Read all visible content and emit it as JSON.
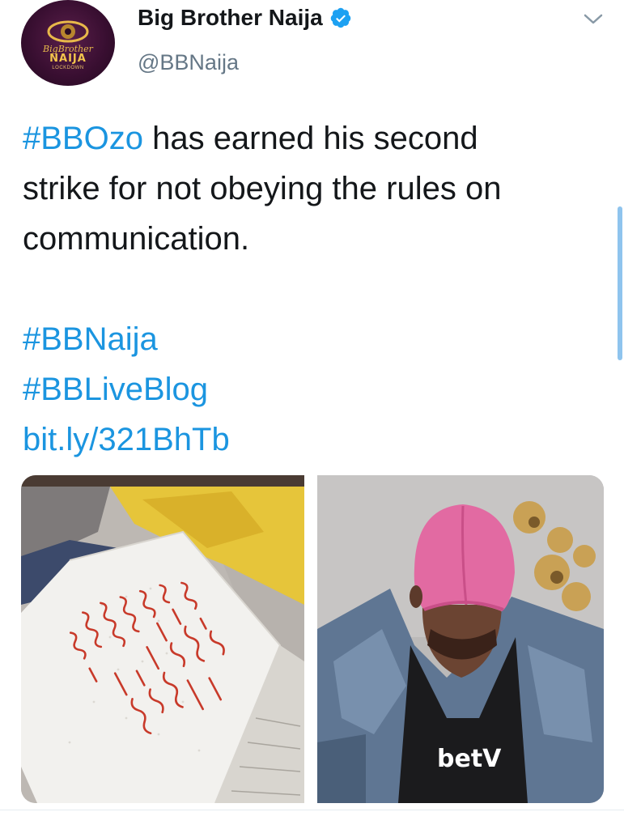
{
  "account": {
    "display_name": "Big Brother Naija",
    "handle": "@BBNaija",
    "verified": true,
    "avatar": {
      "line1": "BigBrother",
      "line2": "NAIJA",
      "line3": "LOCKDOWN"
    }
  },
  "tweet": {
    "line1_hashtag": "#BBOzo",
    "line1_text": " has earned his second",
    "line2": "strike for not obeying the rules on",
    "line3": "communication.",
    "hashtag1": "#BBNaija",
    "hashtag2": "#BBLiveBlog",
    "link": "bit.ly/321BhTb"
  },
  "media": {
    "left_image": "handwritten-note-photo",
    "right_image": "man-in-pink-durag-photo",
    "shirt_logo": "betV"
  },
  "colors": {
    "link": "#1b95e0",
    "handle": "#657786",
    "verified": "#1da1f2",
    "text": "#14171a"
  },
  "icons": [
    "verified-badge-icon",
    "chevron-down-icon"
  ]
}
